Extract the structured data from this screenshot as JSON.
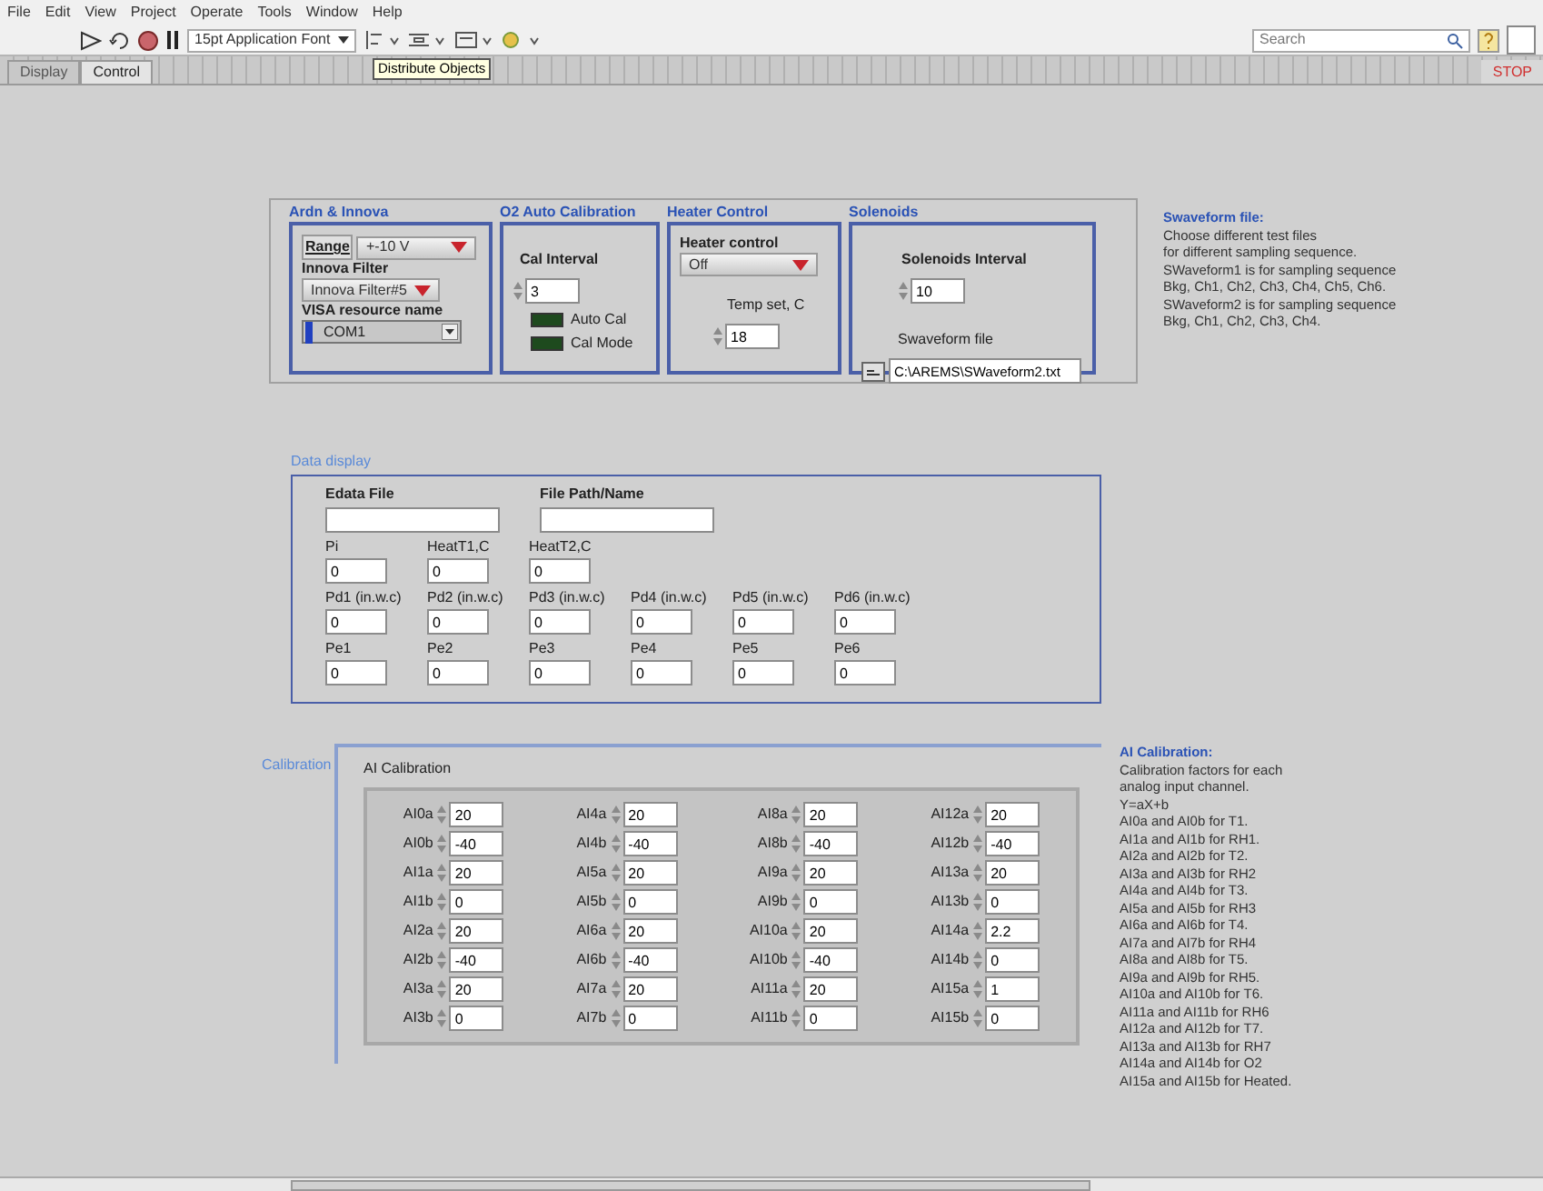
{
  "menu": [
    "File",
    "Edit",
    "View",
    "Project",
    "Operate",
    "Tools",
    "Window",
    "Help"
  ],
  "toolbar": {
    "font": "15pt Application Font",
    "search_placeholder": "Search",
    "tooltip": "Distribute Objects"
  },
  "tabs": [
    {
      "label": "Display",
      "selected": false
    },
    {
      "label": "Control",
      "selected": true
    }
  ],
  "stop_button": "STOP",
  "ardn": {
    "title": "Ardn & Innova",
    "range_label": "Range",
    "range_value": "+-10 V",
    "filter_label": "Innova Filter",
    "filter_value": "Innova Filter#5",
    "visa_label": "VISA resource name",
    "visa_value": "COM1"
  },
  "o2": {
    "title": "O2 Auto Calibration",
    "interval_label": "Cal Interval",
    "interval_value": "3",
    "leds": [
      {
        "label": "Auto Cal",
        "on": false
      },
      {
        "label": "Cal Mode",
        "on": false
      }
    ]
  },
  "heater": {
    "title": "Heater Control",
    "control_label": "Heater control",
    "control_value": "Off",
    "temp_label": "Temp set, C",
    "temp_value": "18"
  },
  "solenoids": {
    "title": "Solenoids",
    "interval_label": "Solenoids Interval",
    "interval_value": "10",
    "file_label": "Swaveform file",
    "file_value": "C:\\AREMS\\SWaveform2.txt"
  },
  "waveform_note": {
    "title": "Swaveform file:",
    "lines": [
      "Choose different test files",
      "for different sampling sequence.",
      "SWaveform1 is for sampling sequence",
      "Bkg, Ch1, Ch2, Ch3, Ch4, Ch5, Ch6.",
      "SWaveform2 is for sampling sequence",
      "Bkg, Ch1, Ch2, Ch3, Ch4."
    ]
  },
  "data_display": {
    "title": "Data display",
    "files": [
      {
        "label": "Edata File"
      },
      {
        "label": "File Path/Name"
      }
    ],
    "rows": [
      [
        {
          "label": "Pi",
          "value": "0"
        },
        {
          "label": "HeatT1,C",
          "value": "0"
        },
        {
          "label": "HeatT2,C",
          "value": "0"
        }
      ],
      [
        {
          "label": "Pd1 (in.w.c)",
          "value": "0"
        },
        {
          "label": "Pd2 (in.w.c)",
          "value": "0"
        },
        {
          "label": "Pd3 (in.w.c)",
          "value": "0"
        },
        {
          "label": "Pd4 (in.w.c)",
          "value": "0"
        },
        {
          "label": "Pd5 (in.w.c)",
          "value": "0"
        },
        {
          "label": "Pd6 (in.w.c)",
          "value": "0"
        }
      ],
      [
        {
          "label": "Pe1",
          "value": "0"
        },
        {
          "label": "Pe2",
          "value": "0"
        },
        {
          "label": "Pe3",
          "value": "0"
        },
        {
          "label": "Pe4",
          "value": "0"
        },
        {
          "label": "Pe5",
          "value": "0"
        },
        {
          "label": "Pe6",
          "value": "0"
        }
      ]
    ]
  },
  "calibration": {
    "title": "Calibration",
    "inner_title": "AI Calibration",
    "columns": [
      [
        {
          "label": "AI0a",
          "value": "20"
        },
        {
          "label": "AI0b",
          "value": "-40"
        },
        {
          "label": "AI1a",
          "value": "20"
        },
        {
          "label": "AI1b",
          "value": "0"
        },
        {
          "label": "AI2a",
          "value": "20"
        },
        {
          "label": "AI2b",
          "value": "-40"
        },
        {
          "label": "AI3a",
          "value": "20"
        },
        {
          "label": "AI3b",
          "value": "0"
        }
      ],
      [
        {
          "label": "AI4a",
          "value": "20"
        },
        {
          "label": "AI4b",
          "value": "-40"
        },
        {
          "label": "AI5a",
          "value": "20"
        },
        {
          "label": "AI5b",
          "value": "0"
        },
        {
          "label": "AI6a",
          "value": "20"
        },
        {
          "label": "AI6b",
          "value": "-40"
        },
        {
          "label": "AI7a",
          "value": "20"
        },
        {
          "label": "AI7b",
          "value": "0"
        }
      ],
      [
        {
          "label": "AI8a",
          "value": "20"
        },
        {
          "label": "AI8b",
          "value": "-40"
        },
        {
          "label": "AI9a",
          "value": "20"
        },
        {
          "label": "AI9b",
          "value": "0"
        },
        {
          "label": "AI10a",
          "value": "20"
        },
        {
          "label": "AI10b",
          "value": "-40"
        },
        {
          "label": "AI11a",
          "value": "20"
        },
        {
          "label": "AI11b",
          "value": "0"
        }
      ],
      [
        {
          "label": "AI12a",
          "value": "20"
        },
        {
          "label": "AI12b",
          "value": "-40"
        },
        {
          "label": "AI13a",
          "value": "20"
        },
        {
          "label": "AI13b",
          "value": "0"
        },
        {
          "label": "AI14a",
          "value": "2.2"
        },
        {
          "label": "AI14b",
          "value": "0"
        },
        {
          "label": "AI15a",
          "value": "1"
        },
        {
          "label": "AI15b",
          "value": "0"
        }
      ]
    ]
  },
  "calibration_note": {
    "title": "AI Calibration:",
    "lines": [
      "Calibration factors for each",
      "analog input channel.",
      "Y=aX+b",
      "AI0a and AI0b for T1.",
      "AI1a and AI1b for RH1.",
      "AI2a and AI2b for T2.",
      "AI3a and AI3b for RH2",
      "AI4a and AI4b for T3.",
      "AI5a and AI5b for RH3",
      "AI6a and AI6b for T4.",
      "AI7a and AI7b for RH4",
      "AI8a and AI8b for T5.",
      "AI9a and AI9b for RH5.",
      "AI10a and AI10b for T6.",
      "AI11a and AI11b for RH6",
      "AI12a and AI12b for T7.",
      "AI13a and AI13b for RH7",
      "AI14a and AI14b for O2",
      "AI15a and AI15b for Heated."
    ]
  }
}
